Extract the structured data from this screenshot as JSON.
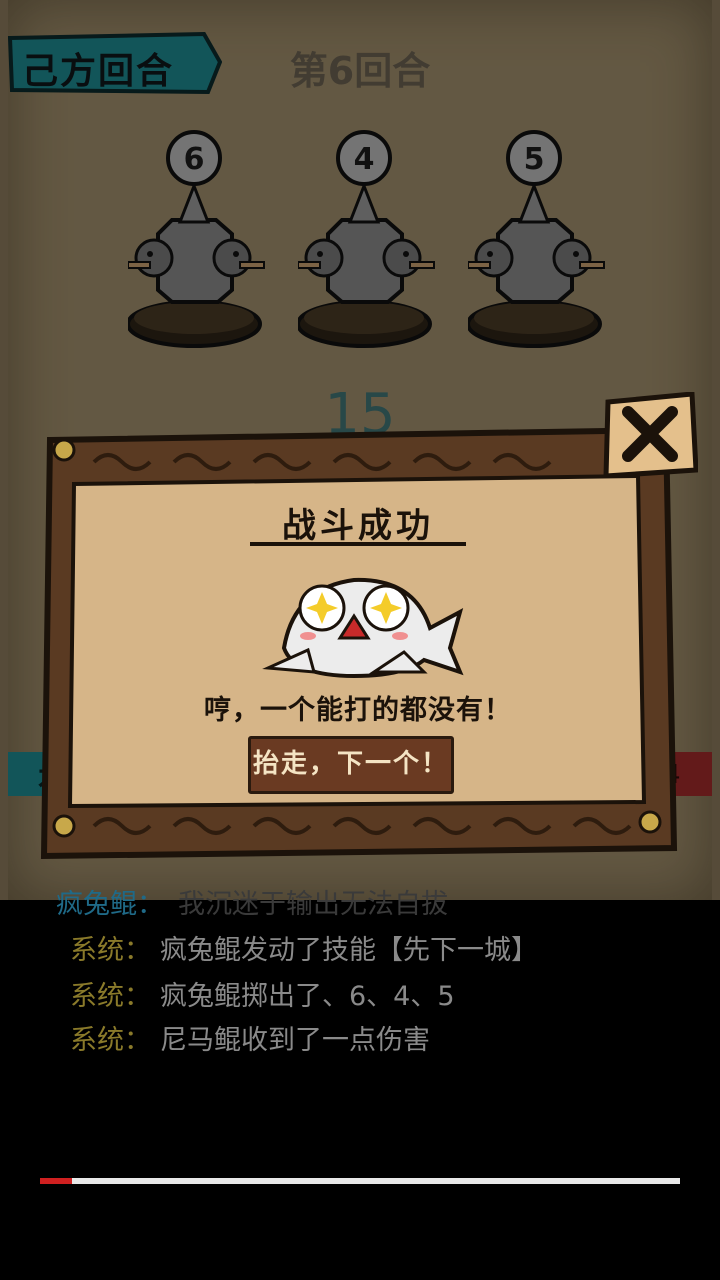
{
  "header": {
    "turn_label": "己方回合",
    "round_label": "第6回合"
  },
  "dice": [
    {
      "value": "6"
    },
    {
      "value": "4"
    },
    {
      "value": "5"
    }
  ],
  "total": "15",
  "side_labels": {
    "left": "本",
    "right": "4"
  },
  "dialog": {
    "title": "战斗成功",
    "message": "哼，一个能打的都没有！",
    "next_button": "抬走，下一个！"
  },
  "log": [
    {
      "speaker": "疯兔鲲：",
      "text": "我沉迷于输出无法自拔",
      "speaker_color": "#1f6a88",
      "text_color": "#3a3a3a"
    },
    {
      "speaker": "系统：",
      "text": "疯兔鲲发动了技能【先下一城】",
      "speaker_color": "#8a7a2a",
      "text_color": "#8a8a8a"
    },
    {
      "speaker": "系统：",
      "text": "疯兔鲲掷出了、6、4、5",
      "speaker_color": "#8a7a2a",
      "text_color": "#8a8a8a"
    },
    {
      "speaker": "系统：",
      "text": "尼马鲲收到了一点伤害",
      "speaker_color": "#8a7a2a",
      "text_color": "#8a8a8a"
    }
  ],
  "progress": {
    "fraction": 0.05
  },
  "colors": {
    "banner_teal": "#1e8a90",
    "parchment": "#d6b588",
    "wood_frame": "#5a3a22",
    "button_brown": "#6a3a22"
  },
  "icons": {
    "close": "close-x-icon",
    "mascot": "fish-mascot-icon",
    "dice": "fish-die-icon"
  }
}
